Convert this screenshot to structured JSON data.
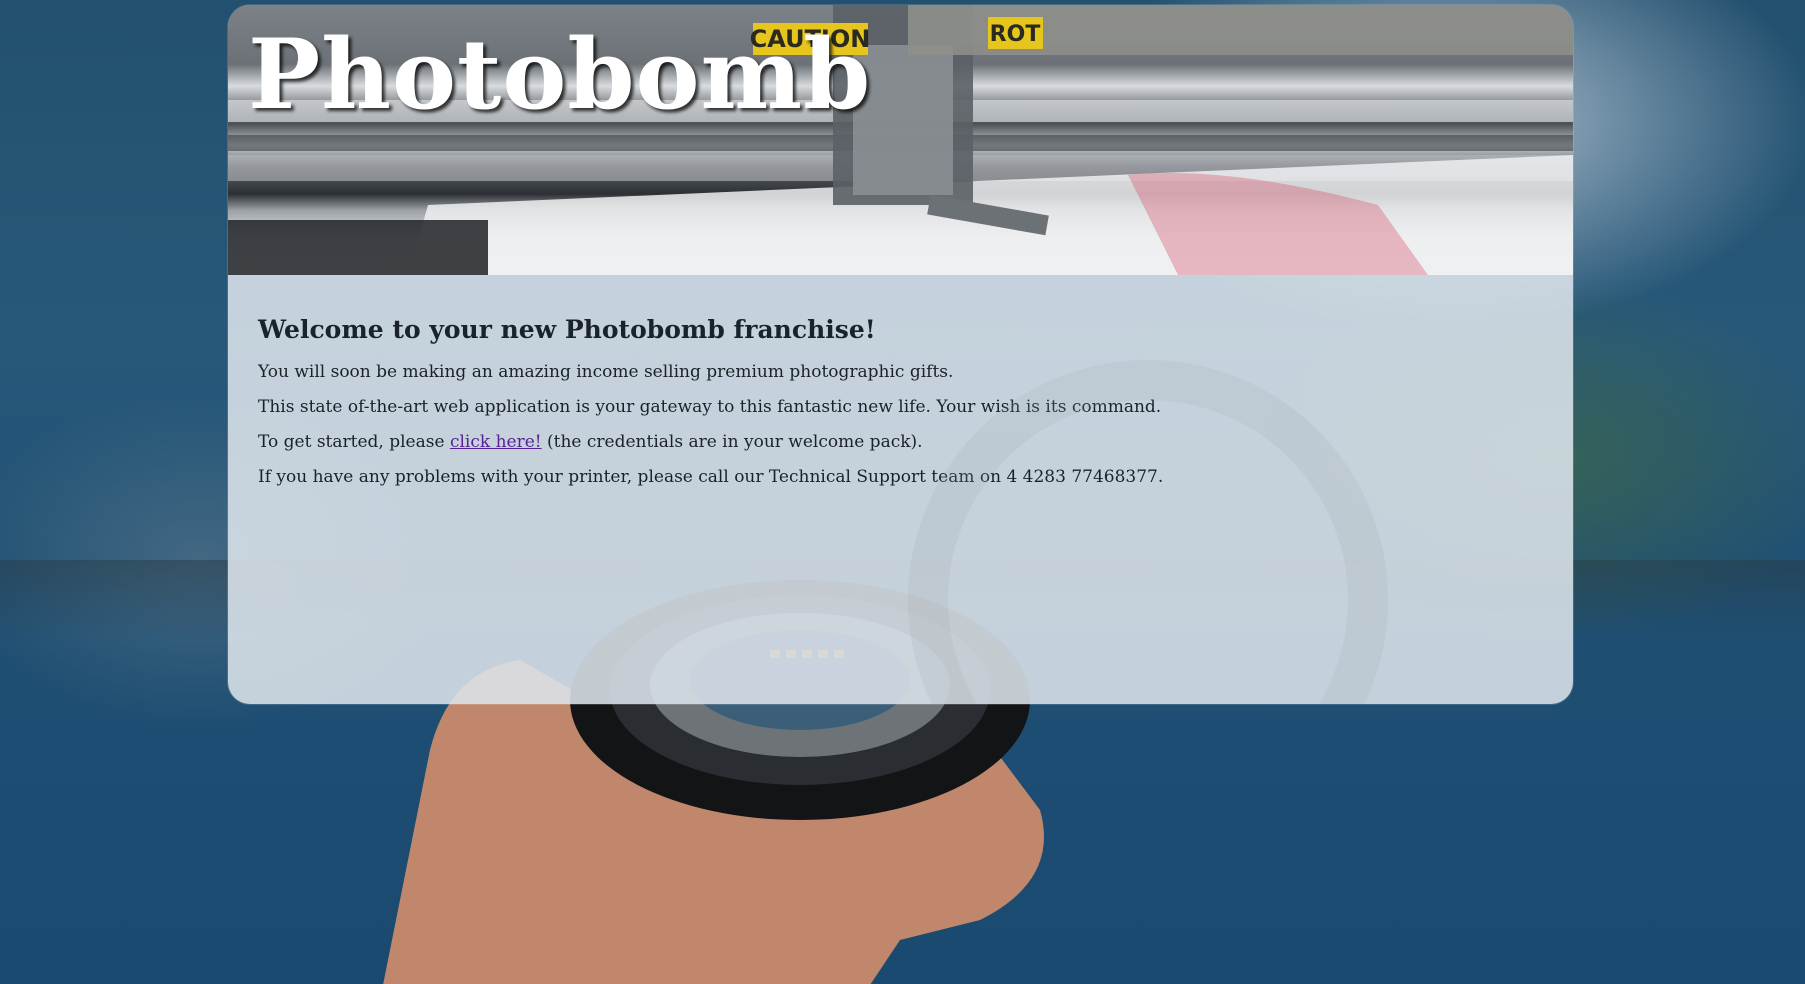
{
  "site": {
    "title": "Photobomb"
  },
  "main": {
    "heading": "Welcome to your new Photobomb franchise!",
    "paragraph_1": "You will soon be making an amazing income selling premium photographic gifts.",
    "paragraph_2": "This state of-the-art web application is your gateway to this fantastic new life. Your wish is its command.",
    "paragraph_3_before": "To get started, please ",
    "paragraph_3_link": "click here!",
    "paragraph_3_after": " (the credentials are in your welcome pack).",
    "paragraph_4": "If you have any problems with your printer, please call our Technical Support team on 4 4283 77468377."
  },
  "banner": {
    "sign_1": "CAUTION",
    "sign_2": "ROT"
  },
  "colors": {
    "link": "#5a1f93",
    "title_text": "#ffffff",
    "panel_bg": "rgba(220,228,235,0.88)"
  }
}
